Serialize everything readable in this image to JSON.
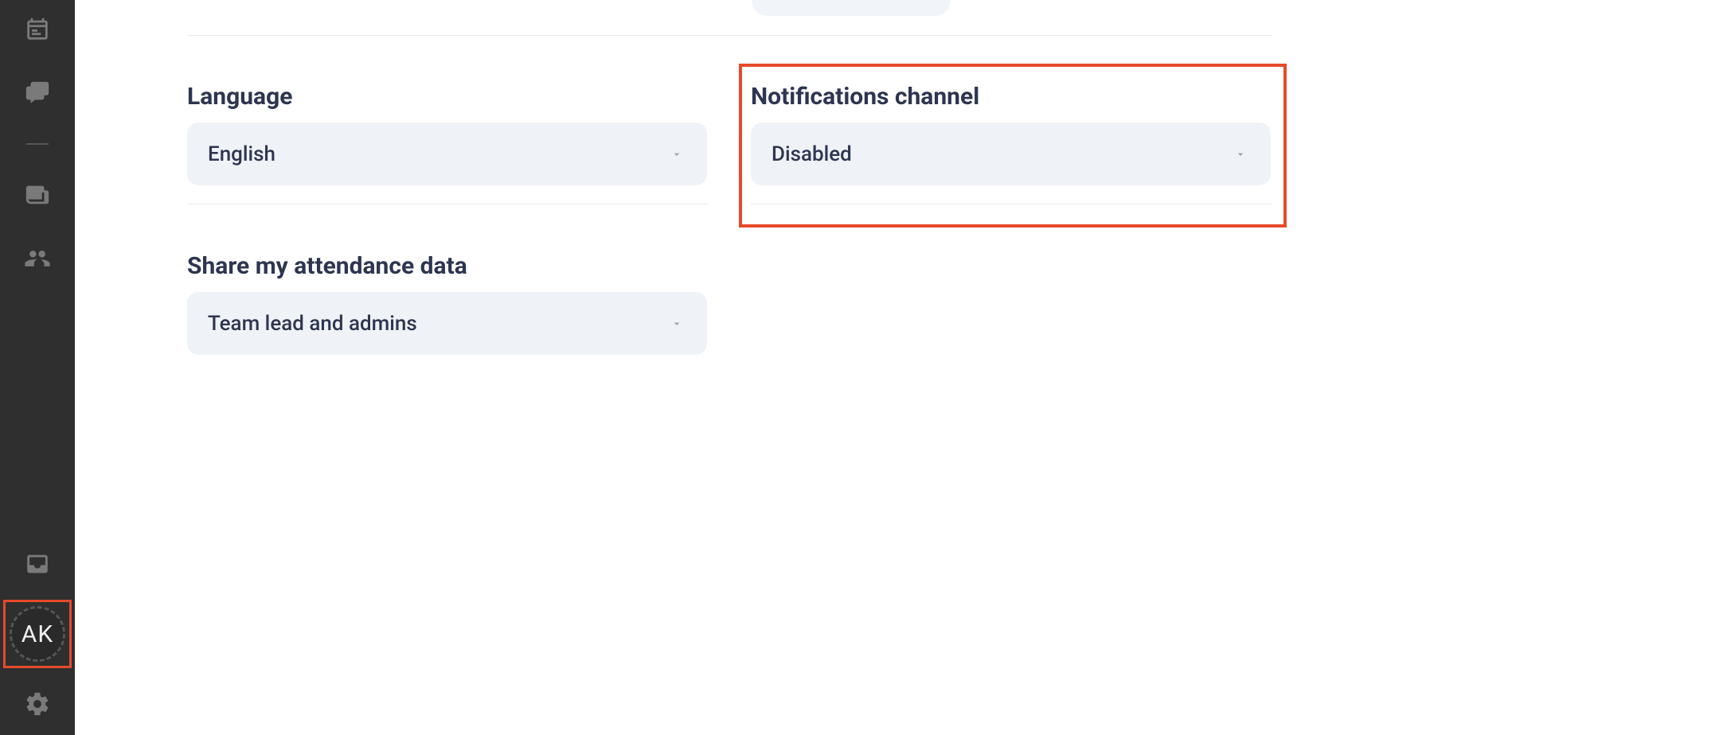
{
  "sidebar": {
    "avatar_initials": "AK"
  },
  "settings": {
    "language": {
      "label": "Language",
      "value": "English"
    },
    "notifications": {
      "label": "Notifications channel",
      "value": "Disabled"
    },
    "share_attendance": {
      "label": "Share my attendance data",
      "value": "Team lead and admins"
    }
  },
  "highlight_color": "#e74a2b"
}
